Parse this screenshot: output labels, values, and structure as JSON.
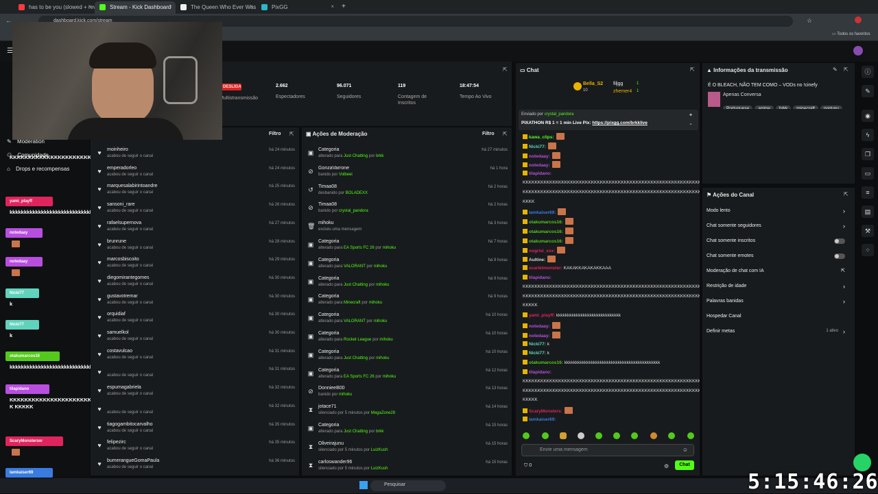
{
  "tabs": [
    {
      "label": "has to be you (slowed + reverb",
      "color": "#ff3b3b"
    },
    {
      "label": "Stream - Kick Dashboard",
      "color": "#53fc18"
    },
    {
      "label": "The Queen Who Ever Was • HE",
      "color": "#eee"
    },
    {
      "label": "PixGG",
      "color": "#2bb6c9"
    }
  ],
  "address": "dashboard.kick.com/stream",
  "bookmarks_label": "Todos os favoritos",
  "stats": {
    "status": "DESLIGADO",
    "multistream": "Multistransmissão",
    "viewers_value": "2.662",
    "viewers_label": "Espectadores",
    "followers_value": "96.071",
    "followers_label": "Seguidores",
    "subs_value": "119",
    "subs_label": "Contagem de Inscritos",
    "time_value": "18:47:54",
    "time_label": "Tempo Ao Vivo"
  },
  "sidebar": {
    "moderation": "Moderation",
    "community": "Comunidade",
    "drops": "Drops e recompensas"
  },
  "left_chat": [
    {
      "user": "",
      "msg": "KKKKKKKKKKKKKKKKKKKKKKKKKKKKKKKKKKKK"
    },
    {
      "user": "yami_playff",
      "msg": "kkkkkkkkkkkkkkkkkkkkkkkkkkkkk",
      "color": "#e0245e"
    },
    {
      "user": "notedaay",
      "msg": "",
      "color": "#b84ee0"
    },
    {
      "user": "notedaay",
      "msg": "",
      "color": "#b84ee0"
    },
    {
      "user": "Nicki77",
      "msg": "k",
      "color": "#5fd3bc"
    },
    {
      "user": "Nicki77",
      "msg": "k",
      "color": "#5fd3bc"
    },
    {
      "user": "otakumarcos16",
      "msg": "kkkkkkkkkkkkkkkkkkkkkkkkkkkkkkkkkkkkk",
      "color": "#53c91b"
    },
    {
      "user": "tilapidano",
      "msg": "KKKKKKKKKKKKKKKKKKKKKKKKKKKKKKKKKKKKKKKK KKKKK",
      "color": "#b84ee0"
    },
    {
      "user": "ScaryMonstersw",
      "msg": "",
      "color": "#e0245e"
    },
    {
      "user": "Iamkaiser69",
      "msg": "",
      "color": "#3a7be0"
    }
  ],
  "followers": {
    "title": "Filtro",
    "items": [
      {
        "name": "moinheiro",
        "time": "há 24 minutos"
      },
      {
        "name": "emperadorleo",
        "time": "há 24 minutos"
      },
      {
        "name": "marquesalabirintoandre",
        "time": "há 25 minutos"
      },
      {
        "name": "sansoni_rare",
        "time": "há 26 minutos"
      },
      {
        "name": "rafaelsupernova",
        "time": "há 27 minutos"
      },
      {
        "name": "brunrune",
        "time": "há 28 minutos"
      },
      {
        "name": "marcosbiscoito",
        "time": "há 29 minutos"
      },
      {
        "name": "diegomirantegomes",
        "time": "há 30 minutos"
      },
      {
        "name": "gustavotremar",
        "time": "há 30 minutos"
      },
      {
        "name": "orquidiaf",
        "time": "há 30 minutos"
      },
      {
        "name": "samuelkol",
        "time": "há 30 minutos"
      },
      {
        "name": "costavulcao",
        "time": "há 31 minutos"
      },
      {
        "name": "",
        "time": "há 31 minutos"
      },
      {
        "name": "espumagabriela",
        "time": "há 32 minutos"
      },
      {
        "name": "",
        "time": "há 32 minutos"
      },
      {
        "name": "tiagogambitocarvalho",
        "time": "há 35 minutos"
      },
      {
        "name": "felipezirc",
        "time": "há 35 minutos"
      },
      {
        "name": "bumeranguеGomaPaula",
        "time": "há 36 minutos"
      }
    ],
    "sub": "acabou de seguir o canal"
  },
  "modactions": {
    "title": "Ações de Moderação",
    "filter": "Filtro",
    "items": [
      {
        "icon": "▣",
        "t1": "Categoria",
        "pre": "alterado para ",
        "hl": "Just Chatting",
        "mid": " por ",
        "by": "brkk",
        "time": "há 27 minutos"
      },
      {
        "icon": "⊘",
        "t1": "GonzaVarrone",
        "pre": "banido por ",
        "hl": "",
        "mid": "",
        "by": "Volbeei",
        "time": "há 1 hora"
      },
      {
        "icon": "↺",
        "t1": "Timaa08",
        "pre": "desbanido por ",
        "hl": "",
        "mid": "",
        "by": "BOLADEXX",
        "time": "há 2 horas"
      },
      {
        "icon": "⊘",
        "t1": "Timaa08",
        "pre": "banido por ",
        "hl": "",
        "mid": "",
        "by": "crystal_pandora",
        "time": "há 2 horas"
      },
      {
        "icon": "🗑",
        "t1": "mihoku",
        "pre": "excluiu uma mensagem",
        "hl": "",
        "mid": "",
        "by": "",
        "time": "há 3 horas"
      },
      {
        "icon": "▣",
        "t1": "Categoria",
        "pre": "alterado para ",
        "hl": "EA Sports FC 26",
        "mid": " por ",
        "by": "mihoku",
        "time": "há 7 horas"
      },
      {
        "icon": "▣",
        "t1": "Categoria",
        "pre": "alterado para ",
        "hl": "VALORANT",
        "mid": " por ",
        "by": "mihoku",
        "time": "há 9 horas"
      },
      {
        "icon": "▣",
        "t1": "Categoria",
        "pre": "alterado para ",
        "hl": "Just Chatting",
        "mid": " por ",
        "by": "mihoku",
        "time": "há 9 horas"
      },
      {
        "icon": "▣",
        "t1": "Categoria",
        "pre": "alterado para ",
        "hl": "Minecraft",
        "mid": " por ",
        "by": "mihoku",
        "time": "há 9 horas"
      },
      {
        "icon": "▣",
        "t1": "Categoria",
        "pre": "alterado para ",
        "hl": "VALORANT",
        "mid": " por ",
        "by": "mihoku",
        "time": "há 10 horas"
      },
      {
        "icon": "▣",
        "t1": "Categoria",
        "pre": "alterado para ",
        "hl": "Rocket League",
        "mid": " por ",
        "by": "mihoku",
        "time": "há 10 horas"
      },
      {
        "icon": "▣",
        "t1": "Categoria",
        "pre": "alterado para ",
        "hl": "Just Chatting",
        "mid": " por ",
        "by": "mihoku",
        "time": "há 10 horas"
      },
      {
        "icon": "▣",
        "t1": "Categoria",
        "pre": "alterado para ",
        "hl": "EA Sports FC 26",
        "mid": " por ",
        "by": "mihoku",
        "time": "há 12 horas"
      },
      {
        "icon": "⊘",
        "t1": "DonnieeB00",
        "pre": "banido por ",
        "hl": "",
        "mid": "",
        "by": "mihoku",
        "time": "há 13 horas"
      },
      {
        "icon": "⧗",
        "t1": "jotace71",
        "pre": "silenciado por 5 minutos por ",
        "hl": "",
        "mid": "",
        "by": "MegaZone28",
        "time": "há 14 horas"
      },
      {
        "icon": "▣",
        "t1": "Categoria",
        "pre": "alterado para ",
        "hl": "Just Chatting",
        "mid": " por ",
        "by": "brkk",
        "time": "há 15 horas"
      },
      {
        "icon": "⧗",
        "t1": "Oliveirajunu",
        "pre": "silenciado por 5 minutos por ",
        "hl": "",
        "mid": "",
        "by": "LuizKush",
        "time": "há 15 horas"
      },
      {
        "icon": "⧗",
        "t1": "carloswander96",
        "pre": "silenciado por 5 minutos por ",
        "hl": "",
        "mid": "",
        "by": "LuizKush",
        "time": "há 15 horas"
      }
    ]
  },
  "chat": {
    "title": "Chat",
    "leader1": "Bella_S2",
    "leader1_n": "10",
    "leader2": "filjgg",
    "leader2_n": "1",
    "leader3": "zhemer4",
    "leader3_n": "1",
    "pinned_by": "Enviado por",
    "pinned_user": "crystal_pandora",
    "pinned_text": "PIXATHON R$ 1 = 1 min Live Pix: ",
    "pinned_link": "https://pixgg.com/brkklive",
    "input_placeholder": "Envie uma mensagem",
    "send": "Chat",
    "count": "0",
    "messages": [
      {
        "user": "kawa_clips:",
        "color": "#53fc18",
        "msg": "",
        "emo": 1
      },
      {
        "user": "Nicki77:",
        "color": "#5fd3bc",
        "msg": "",
        "emo": 1
      },
      {
        "user": "notedaay:",
        "color": "#b84ee0",
        "msg": "",
        "emo": 1
      },
      {
        "user": "notedaay:",
        "color": "#b84ee0",
        "msg": "",
        "emo": 1
      },
      {
        "user": "tilapidano:",
        "color": "#b84ee0",
        "msg": "",
        "emo": 0
      },
      {
        "user": "",
        "color": "#ddd",
        "msg": "KKKKKKKKKKKKKKKKKKKKKKKKKKKKKKKKKKKKKKKKKKKKKKKKKKKKKKKKKKKKKKKKKKKK",
        "emo": 0
      },
      {
        "user": "",
        "color": "#ddd",
        "msg": "KKKKKKKKKKKKKKKKKKKKKKKKKKKKKKKKKKKKKKKKKKKKKKKKKKKKKKKKKKKKKKKKKKKK",
        "emo": 0
      },
      {
        "user": "",
        "color": "#ddd",
        "msg": "KKKK",
        "emo": 0
      },
      {
        "user": "Iamkaiser69:",
        "color": "#3a7be0",
        "msg": "",
        "emo": 1
      },
      {
        "user": "otakumarcos16:",
        "color": "#53c91b",
        "msg": "",
        "emo": 1
      },
      {
        "user": "otakumarcos16:",
        "color": "#53c91b",
        "msg": "",
        "emo": 1
      },
      {
        "user": "otakumarcos16:",
        "color": "#53c91b",
        "msg": "",
        "emo": 1
      },
      {
        "user": "nogrisl_xxx:",
        "color": "#e0245e",
        "msg": "",
        "emo": 1
      },
      {
        "user": "Aultine:",
        "color": "#ddd",
        "msg": "",
        "emo": 1
      },
      {
        "user": "scarletmonster:",
        "color": "#e0245e",
        "msg": " KAKAKKAKAKAKKAAA",
        "emo": 0
      },
      {
        "user": "tilapidano:",
        "color": "#b84ee0",
        "msg": "",
        "emo": 0
      },
      {
        "user": "",
        "color": "#ddd",
        "msg": "KKKKKKKKKKKKKKKKKKKKKKKKKKKKKKKKKKKKKKKKKKKKKKKKKKKKKKKKKKKKKKKKKKKK",
        "emo": 0
      },
      {
        "user": "",
        "color": "#ddd",
        "msg": "KKKKKKKKKKKKKKKKKKKKKKKKKKKKKKKKKKKKKKKKKKKKKKKKKKKKKKKKKKKKKKKKKKKK",
        "emo": 0
      },
      {
        "user": "",
        "color": "#ddd",
        "msg": "KKKKK",
        "emo": 0
      },
      {
        "user": "yami_playff:",
        "color": "#e0245e",
        "msg": " kkkkkkkkkkkkkkkkkkkkkkkkkkkkk",
        "emo": 0
      },
      {
        "user": "notedaay:",
        "color": "#b84ee0",
        "msg": "",
        "emo": 1
      },
      {
        "user": "notedaay:",
        "color": "#b84ee0",
        "msg": "",
        "emo": 1
      },
      {
        "user": "Nicki77:",
        "color": "#5fd3bc",
        "msg": " k",
        "emo": 0
      },
      {
        "user": "Nicki77:",
        "color": "#5fd3bc",
        "msg": " k",
        "emo": 0
      },
      {
        "user": "otakumarcos16:",
        "color": "#53c91b",
        "msg": " kkkkkkkkkkkkkkkkkkkkkkkkkkkkkkkkkkkkkkkkkkk",
        "emo": 0
      },
      {
        "user": "tilapidano:",
        "color": "#b84ee0",
        "msg": "",
        "emo": 0
      },
      {
        "user": "",
        "color": "#ddd",
        "msg": "KKKKKKKKKKKKKKKKKKKKKKKKKKKKKKKKKKKKKKKKKKKKKKKKKKKKKKKKKKKKKKKKKKKK",
        "emo": 0
      },
      {
        "user": "",
        "color": "#ddd",
        "msg": "KKKKKKKKKKKKKKKKKKKKKKKKKKKKKKKKKKKKKKKKKKKKKKKKKKKKKKKKKKKKKKKKKKKK",
        "emo": 0
      },
      {
        "user": "",
        "color": "#ddd",
        "msg": "KKKKK",
        "emo": 0
      },
      {
        "user": "ScaryMonsters:",
        "color": "#e0245e",
        "msg": "",
        "emo": 1
      },
      {
        "user": "Iamkaiser69:",
        "color": "#3a7be0",
        "msg": "",
        "emo": 0
      }
    ]
  },
  "info": {
    "title": "Informações da transmissão",
    "stream_title": "É O BLEACH, NÃO TEM COMO – VODs no !cinefy",
    "category": "Apenas Conversa",
    "tags": [
      "Portuguese",
      "anime",
      "brkk",
      "minecraft",
      "portugu"
    ]
  },
  "actions": {
    "title": "Ações do Canal",
    "items": [
      {
        "label": "Modo lento",
        "type": "arrow"
      },
      {
        "label": "Chat somente seguidores",
        "type": "arrow"
      },
      {
        "label": "Chat somente inscritos",
        "type": "toggle"
      },
      {
        "label": "Chat somente emotes",
        "type": "toggle"
      },
      {
        "label": "Moderação de chat com IA",
        "type": "ext"
      },
      {
        "label": "Restrição de idade",
        "type": "arrow"
      },
      {
        "label": "Palavras banidas",
        "type": "arrow"
      },
      {
        "label": "Hospedar Canal",
        "type": "none"
      },
      {
        "label": "Definir metas",
        "type": "meta"
      }
    ],
    "meta_status": "1 ativo"
  },
  "taskbar": {
    "search": "Pesquisar"
  },
  "overlay_clock": "5:15:46:26"
}
